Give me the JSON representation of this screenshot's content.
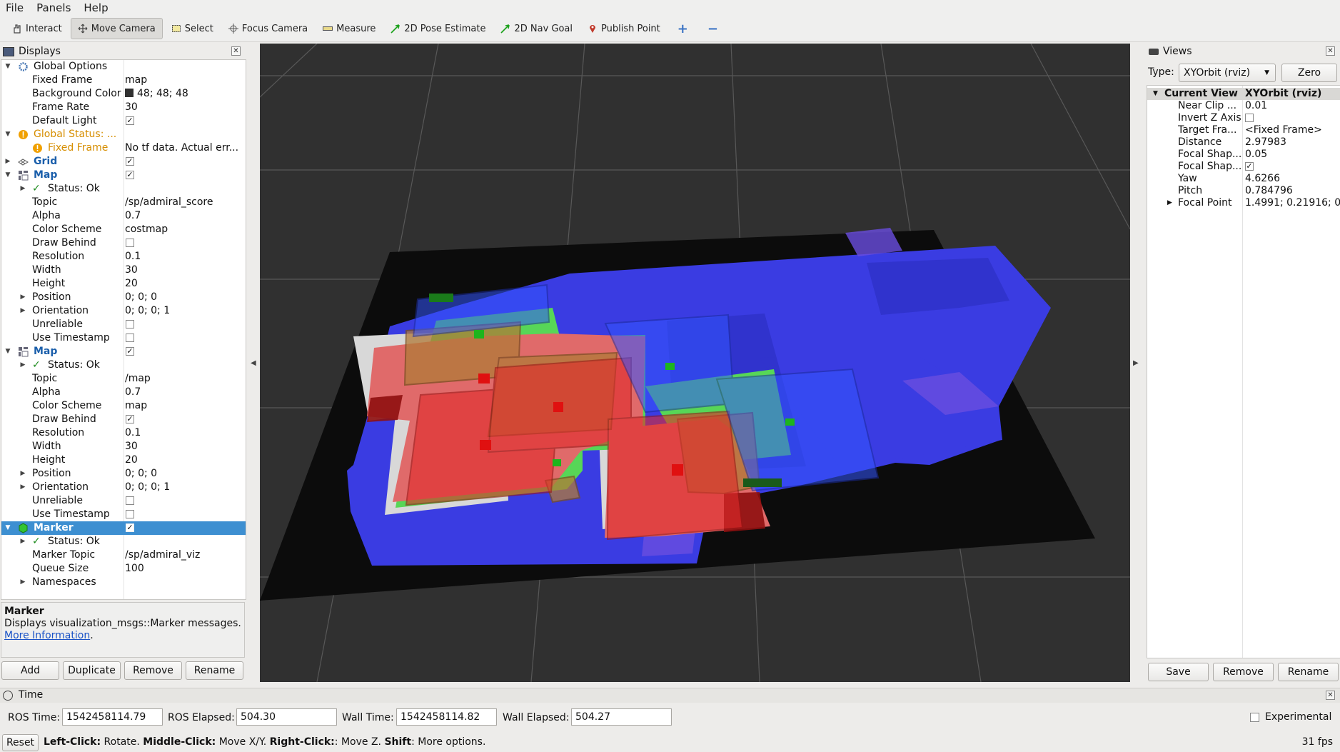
{
  "menu": [
    "File",
    "Panels",
    "Help"
  ],
  "toolbar": {
    "tools": [
      {
        "label": "Interact",
        "icon": "hand-icon"
      },
      {
        "label": "Move Camera",
        "icon": "move-camera-icon",
        "active": true
      },
      {
        "label": "Select",
        "icon": "select-icon"
      },
      {
        "label": "Focus Camera",
        "icon": "focus-camera-icon"
      },
      {
        "label": "Measure",
        "icon": "measure-icon"
      },
      {
        "label": "2D Pose Estimate",
        "icon": "pose-arrow-icon"
      },
      {
        "label": "2D Nav Goal",
        "icon": "nav-goal-arrow-icon"
      },
      {
        "label": "Publish Point",
        "icon": "map-pin-icon"
      }
    ]
  },
  "displays": {
    "title": "Displays",
    "rows": {
      "global_options": "Global Options",
      "fixed_frame_label": "Fixed Frame",
      "fixed_frame_value": "map",
      "bg_color_label": "Background Color",
      "bg_color_value": "48; 48; 48",
      "frame_rate_label": "Frame Rate",
      "frame_rate_value": "30",
      "default_light_label": "Default Light",
      "default_light_checked": true,
      "global_status": "Global Status: ...",
      "gs_fixed_frame_label": "Fixed Frame",
      "gs_fixed_frame_value": "No tf data.  Actual err...",
      "grid": "Grid",
      "map1": "Map",
      "map1_status": "Status: Ok",
      "map1_topic_label": "Topic",
      "map1_topic_value": "/sp/admiral_score",
      "map1_alpha_label": "Alpha",
      "map1_alpha_value": "0.7",
      "map1_scheme_label": "Color Scheme",
      "map1_scheme_value": "costmap",
      "map1_drawbehind_label": "Draw Behind",
      "map1_res_label": "Resolution",
      "map1_res_value": "0.1",
      "map1_width_label": "Width",
      "map1_width_value": "30",
      "map1_height_label": "Height",
      "map1_height_value": "20",
      "map1_pos_label": "Position",
      "map1_pos_value": "0; 0; 0",
      "map1_orient_label": "Orientation",
      "map1_orient_value": "0; 0; 0; 1",
      "map1_unrel_label": "Unreliable",
      "map1_usets_label": "Use Timestamp",
      "map2": "Map",
      "map2_status": "Status: Ok",
      "map2_topic_label": "Topic",
      "map2_topic_value": "/map",
      "map2_alpha_label": "Alpha",
      "map2_alpha_value": "0.7",
      "map2_scheme_label": "Color Scheme",
      "map2_scheme_value": "map",
      "map2_drawbehind_label": "Draw Behind",
      "map2_res_label": "Resolution",
      "map2_res_value": "0.1",
      "map2_width_label": "Width",
      "map2_width_value": "30",
      "map2_height_label": "Height",
      "map2_height_value": "20",
      "map2_pos_label": "Position",
      "map2_pos_value": "0; 0; 0",
      "map2_orient_label": "Orientation",
      "map2_orient_value": "0; 0; 0; 1",
      "map2_unrel_label": "Unreliable",
      "map2_usets_label": "Use Timestamp",
      "marker": "Marker",
      "marker_status": "Status: Ok",
      "marker_topic_label": "Marker Topic",
      "marker_topic_value": "/sp/admiral_viz",
      "marker_queue_label": "Queue Size",
      "marker_queue_value": "100",
      "marker_ns_label": "Namespaces"
    },
    "description": {
      "title": "Marker",
      "text": "Displays visualization_msgs::Marker messages.",
      "link": "More Information",
      "link_suffix": "."
    },
    "buttons": {
      "add": "Add",
      "duplicate": "Duplicate",
      "remove": "Remove",
      "rename": "Rename"
    }
  },
  "views": {
    "title": "Views",
    "type_label": "Type:",
    "type_value": "XYOrbit (rviz)",
    "zero": "Zero",
    "current_view_label": "Current View",
    "current_view_value": "XYOrbit (rviz)",
    "near_clip_label": "Near Clip ...",
    "near_clip_value": "0.01",
    "invert_z_label": "Invert Z Axis",
    "target_frame_label": "Target Fra...",
    "target_frame_value": "<Fixed Frame>",
    "distance_label": "Distance",
    "distance_value": "2.97983",
    "focal_shape1_label": "Focal Shap...",
    "focal_shape1_value": "0.05",
    "focal_shape2_label": "Focal Shap...",
    "yaw_label": "Yaw",
    "yaw_value": "4.6266",
    "pitch_label": "Pitch",
    "pitch_value": "0.784796",
    "focal_point_label": "Focal Point",
    "focal_point_value": "1.4991; 0.21916; 0",
    "buttons": {
      "save": "Save",
      "remove": "Remove",
      "rename": "Rename"
    }
  },
  "time": {
    "title": "Time",
    "ros_time_label": "ROS Time:",
    "ros_time_value": "1542458114.79",
    "ros_elapsed_label": "ROS Elapsed:",
    "ros_elapsed_value": "504.30",
    "wall_time_label": "Wall Time:",
    "wall_time_value": "1542458114.82",
    "wall_elapsed_label": "Wall Elapsed:",
    "wall_elapsed_value": "504.27",
    "experimental": "Experimental"
  },
  "status": {
    "reset": "Reset",
    "hint_b1": "Left-Click:",
    "hint_t1": " Rotate. ",
    "hint_b2": "Middle-Click:",
    "hint_t2": " Move X/Y. ",
    "hint_b3": "Right-Click:",
    "hint_t3": ": Move Z. ",
    "hint_b4": "Shift",
    "hint_t4": ": More options.",
    "fps": "31 fps"
  },
  "colors": {
    "viewport_bg": "#303030",
    "selection": "#3d8fd1",
    "costmap_free": "#3a3de0",
    "occupied": "#e06a6a",
    "marker_green": "#18d018",
    "marker_red": "#e01010"
  }
}
